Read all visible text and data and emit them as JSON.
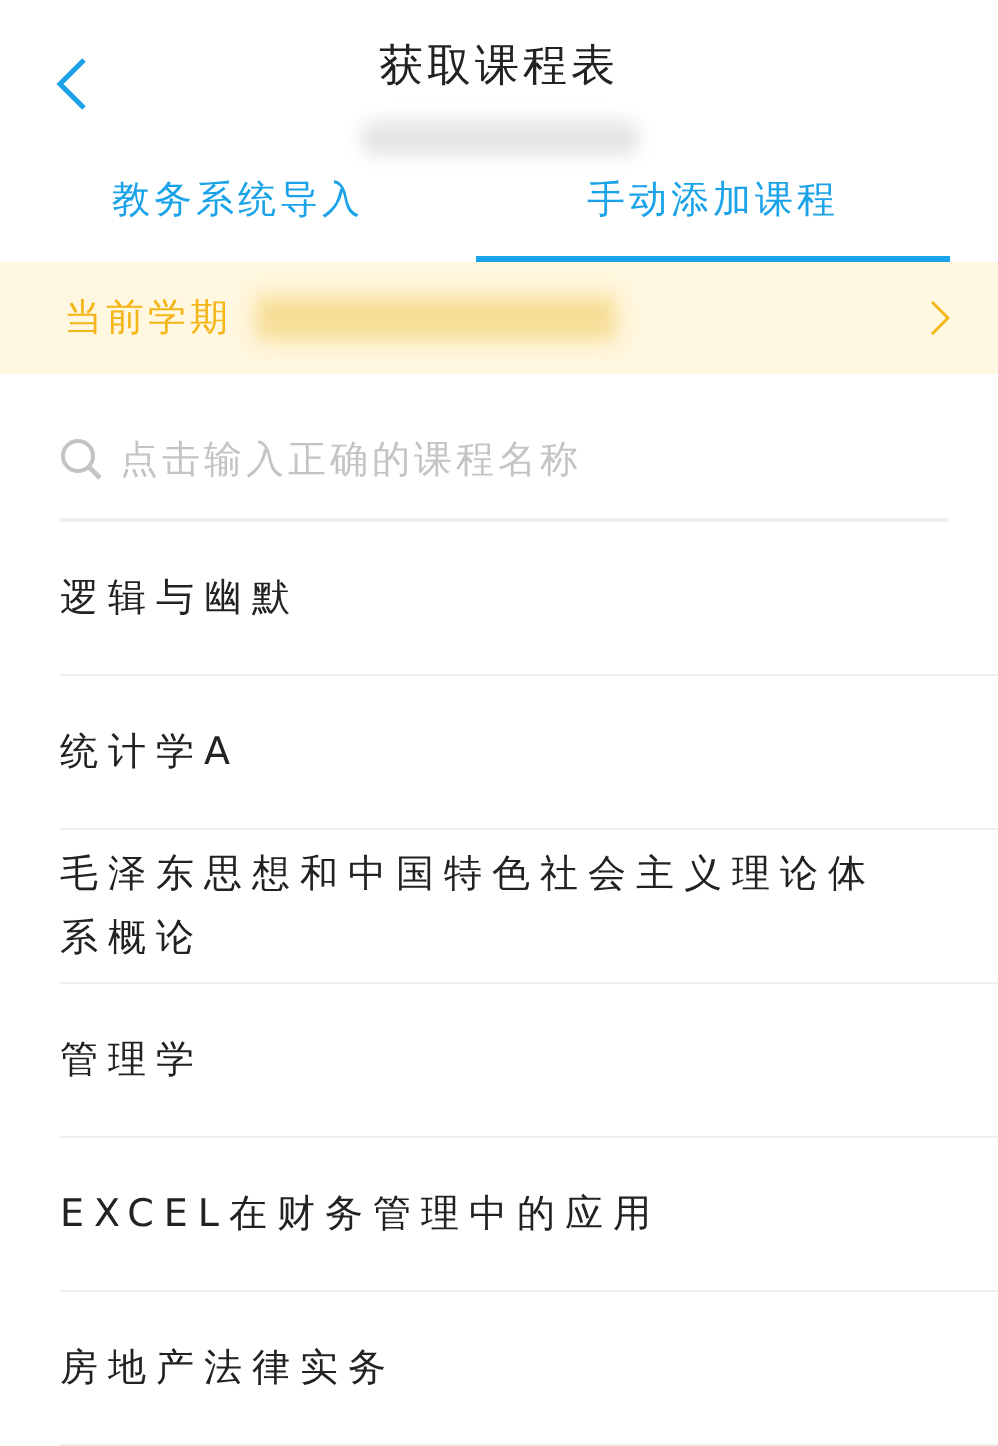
{
  "header": {
    "title": "获取课程表"
  },
  "tabs": [
    {
      "label": "教务系统导入",
      "selected": false
    },
    {
      "label": "手动添加课程",
      "selected": true
    }
  ],
  "term": {
    "label": "当前学期"
  },
  "search": {
    "placeholder": "点击输入正确的课程名称"
  },
  "courses": [
    {
      "name": "逻辑与幽默"
    },
    {
      "name": "统计学A"
    },
    {
      "name": "毛泽东思想和中国特色社会主义理论体系概论"
    },
    {
      "name": "管理学"
    },
    {
      "name": "EXCEL在财务管理中的应用"
    },
    {
      "name": "房地产法律实务"
    }
  ]
}
